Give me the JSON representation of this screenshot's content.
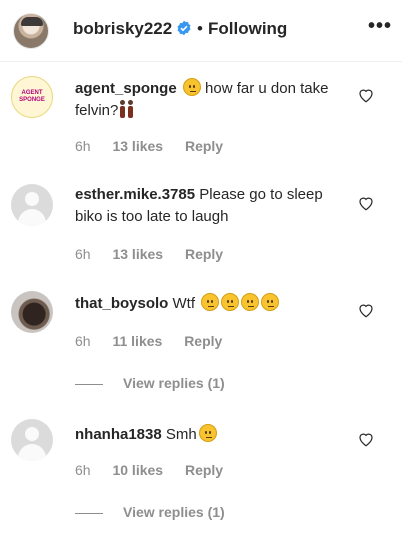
{
  "header": {
    "username": "bobrisky222",
    "separator": "•",
    "follow_status": "Following",
    "more_icon": "more-horizontal-icon",
    "verified_icon": "verified-badge-icon"
  },
  "comments": [
    {
      "username": "agent_sponge",
      "text": "how far u don take felvin?",
      "time": "6h",
      "likes": "13 likes",
      "reply": "Reply",
      "avatar_label": "AGENT SPONGE"
    },
    {
      "username": "esther.mike.3785",
      "text": "Please go to sleep biko is too late to laugh",
      "time": "6h",
      "likes": "13 likes",
      "reply": "Reply"
    },
    {
      "username": "that_boysolo",
      "text": "Wtf",
      "time": "6h",
      "likes": "11 likes",
      "reply": "Reply",
      "view_replies": "View replies (1)"
    },
    {
      "username": "nhanha1838",
      "text": "Smh",
      "time": "6h",
      "likes": "10 likes",
      "reply": "Reply",
      "view_replies": "View replies (1)"
    }
  ],
  "colors": {
    "text": "#262626",
    "secondary": "#8e8e8e",
    "verified": "#3897f0"
  }
}
